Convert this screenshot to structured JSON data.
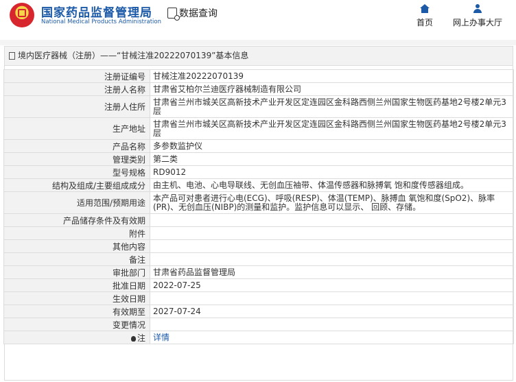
{
  "header": {
    "org_cn": "国家药品监督管理局",
    "org_en": "National Medical Products Administration",
    "query_label": "数据查询",
    "nav": [
      {
        "label": "首页",
        "icon": "home-icon"
      },
      {
        "label": "网上办事大厅",
        "icon": "user-icon"
      }
    ]
  },
  "panel": {
    "title": "境内医疗器械（注册）——“甘械注准20222070139”基本信息"
  },
  "rows": [
    {
      "label": "注册证编号",
      "value": "甘械注准20222070139"
    },
    {
      "label": "注册人名称",
      "value": "甘肃省艾柏尔兰迪医疗器械制造有限公司"
    },
    {
      "label": "注册人住所",
      "value": "甘肃省兰州市城关区高新技术产业开发区定连园区金科路西侧兰州国家生物医药基地2号楼2单元3层"
    },
    {
      "label": "生产地址",
      "value": "甘肃省兰州市城关区高新技术产业开发区定连园区金科路西侧兰州国家生物医药基地2号楼2单元3层"
    },
    {
      "label": "产品名称",
      "value": "多参数监护仪"
    },
    {
      "label": "管理类别",
      "value": "第二类"
    },
    {
      "label": "型号规格",
      "value": "RD9012"
    },
    {
      "label": "结构及组成/主要组成成分",
      "value": "由主机、电池、心电导联线、无创血压袖带、体温传感器和脉搏氧 饱和度传感器组成。"
    },
    {
      "label": "适用范围/预期用途",
      "value": "本产品可对患者进行心电(ECG)、呼吸(RESP)、体温(TEMP)、脉搏血 氧饱和度(SpO2)、脉率(PR)、无创血压(NIBP)的测量和监护。监护信息可以显示、 回顾、存储。"
    },
    {
      "label": "产品储存条件及有效期",
      "value": ""
    },
    {
      "label": "附件",
      "value": ""
    },
    {
      "label": "其他内容",
      "value": ""
    },
    {
      "label": "备注",
      "value": ""
    },
    {
      "label": "审批部门",
      "value": "甘肃省药品监督管理局"
    },
    {
      "label": "批准日期",
      "value": "2022-07-25"
    },
    {
      "label": "生效日期",
      "value": ""
    },
    {
      "label": "有效期至",
      "value": "2027-07-24"
    },
    {
      "label": "变更情况",
      "value": ""
    },
    {
      "label": "注",
      "value": "详情"
    }
  ]
}
